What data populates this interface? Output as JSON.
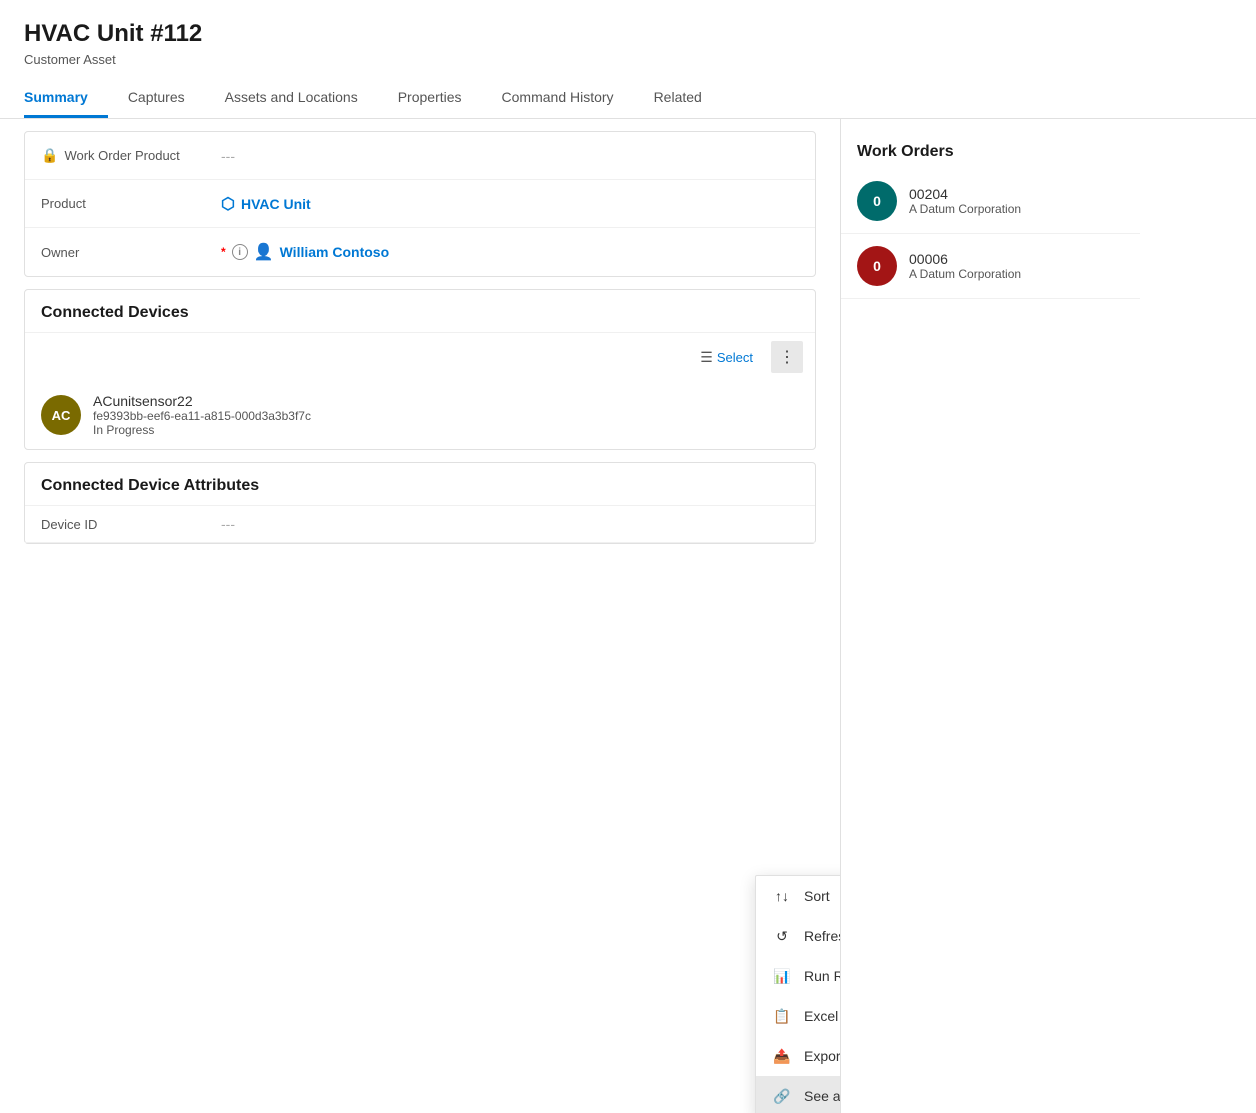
{
  "header": {
    "title": "HVAC Unit #112",
    "subtitle": "Customer Asset"
  },
  "tabs": [
    {
      "id": "summary",
      "label": "Summary",
      "active": true
    },
    {
      "id": "captures",
      "label": "Captures",
      "active": false
    },
    {
      "id": "assets-locations",
      "label": "Assets and Locations",
      "active": false
    },
    {
      "id": "properties",
      "label": "Properties",
      "active": false
    },
    {
      "id": "command-history",
      "label": "Command History",
      "active": false
    },
    {
      "id": "related",
      "label": "Related",
      "active": false
    }
  ],
  "form": {
    "work_order_product_label": "Work Order Product",
    "work_order_product_value": "---",
    "product_label": "Product",
    "product_value": "HVAC Unit",
    "owner_label": "Owner",
    "owner_value": "William Contoso"
  },
  "connected_devices": {
    "section_title": "Connected Devices",
    "select_label": "Select",
    "device": {
      "initials": "AC",
      "name": "ACunitsensor22",
      "id": "fe9393bb-eef6-ea11-a815-000d3a3b3f7c",
      "status": "In Progress"
    }
  },
  "connected_device_attributes": {
    "section_title": "Connected Device Attributes",
    "device_id_label": "Device ID",
    "device_id_value": "---"
  },
  "work_orders": {
    "panel_title": "Work Orders",
    "items": [
      {
        "badge": "0",
        "badge_color": "teal",
        "number": "00204",
        "company": "A Datum Corporation"
      },
      {
        "badge": "0",
        "badge_color": "red",
        "number": "00006",
        "company": "A Datum Corporation"
      }
    ]
  },
  "context_menu": {
    "items": [
      {
        "id": "sort",
        "label": "Sort",
        "icon": "↑↓",
        "has_arrow": false
      },
      {
        "id": "refresh",
        "label": "Refresh",
        "icon": "↺",
        "has_arrow": false
      },
      {
        "id": "run-report",
        "label": "Run Report",
        "icon": "📊",
        "has_arrow": true
      },
      {
        "id": "excel-templates",
        "label": "Excel Templates",
        "icon": "📋",
        "has_arrow": true
      },
      {
        "id": "export-connections",
        "label": "Export Connections",
        "icon": "📤",
        "has_arrow": true,
        "has_sep": true
      },
      {
        "id": "see-associated",
        "label": "See associated records",
        "icon": "🔗",
        "has_arrow": false,
        "highlighted": true
      }
    ]
  }
}
